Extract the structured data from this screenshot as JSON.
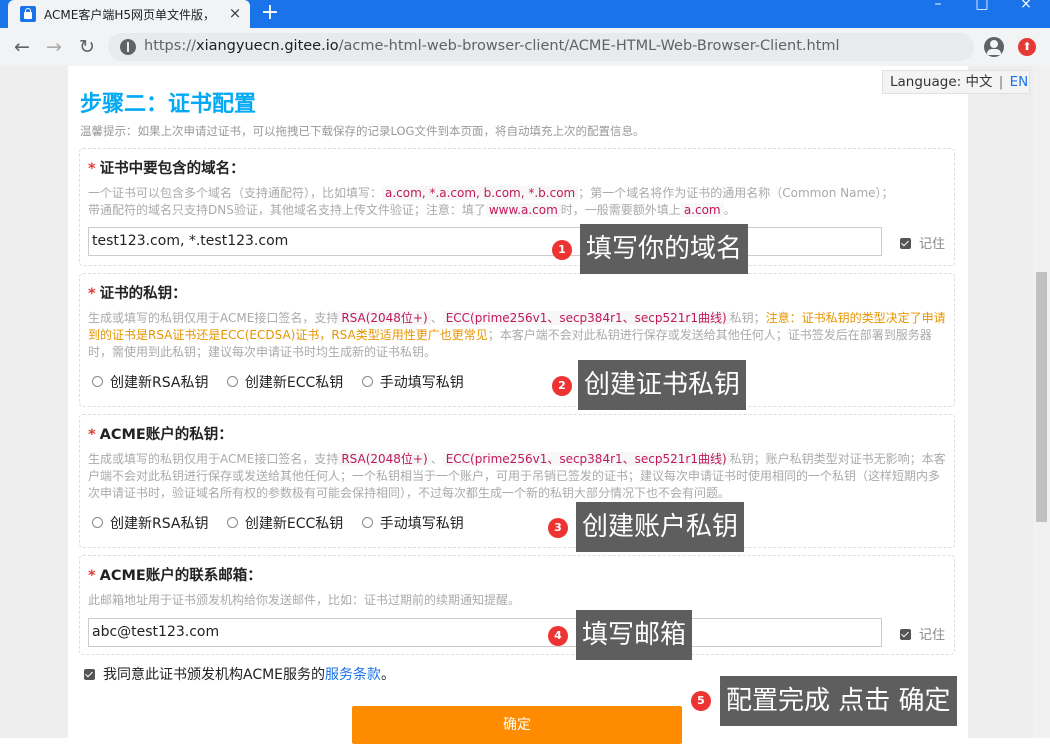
{
  "browser": {
    "tab_title": "ACME客户端H5网页单文件版，",
    "tab_close": "×",
    "new_tab": "+",
    "url_prefix": "https://",
    "url_host": "xiangyuecn.gitee.io",
    "url_path": "/acme-html-web-browser-client/ACME-HTML-Web-Browser-Client.html"
  },
  "language": {
    "label": "Language:",
    "zh": "中文",
    "sep": "|",
    "en": "EN"
  },
  "step": {
    "title": "步骤二：证书配置",
    "tip": "温馨提示：如果上次申请过证书，可以拖拽已下载保存的记录LOG文件到本页面，将自动填充上次的配置信息。"
  },
  "domains": {
    "required": "*",
    "title": "证书中要包含的域名：",
    "desc1_a": "一个证书可以包含多个域名（支持通配符），比如填写：",
    "desc1_code": "a.com, *.a.com, b.com, *.b.com",
    "desc1_b": "；第一个域名将作为证书的通用名称（Common Name）；",
    "desc2_a": "带通配符的域名只支持DNS验证，其他域名支持上传文件验证；注意：填了",
    "desc2_code1": "www.a.com",
    "desc2_b": "时，一般需要额外填上",
    "desc2_code2": "a.com",
    "desc2_c": "。",
    "value": "test123.com, *.test123.com",
    "remember": "记住"
  },
  "cert_key": {
    "required": "*",
    "title": "证书的私钥：",
    "d_a": "生成或填写的私钥仅用于ACME接口签名，支持",
    "d_rsa": "RSA(2048位+)",
    "d_sep": "、",
    "d_ecc": "ECC(prime256v1、secp384r1、secp521r1曲线)",
    "d_b": "私钥；",
    "d_warn": "注意：证书私钥的类型决定了申请到的证书是RSA证书还是ECC(ECDSA)证书，RSA类型适用性更广也更常见",
    "d_c": "；本客户端不会对此私钥进行保存或发送给其他任何人；证书签发后在部署到服务器时，需使用到此私钥；建议每次申请证书时均生成新的证书私钥。",
    "options": [
      "创建新RSA私钥",
      "创建新ECC私钥",
      "手动填写私钥"
    ]
  },
  "account_key": {
    "required": "*",
    "title": "ACME账户的私钥：",
    "d_a": "生成或填写的私钥仅用于ACME接口签名，支持",
    "d_rsa": "RSA(2048位+)",
    "d_sep": "、",
    "d_ecc": "ECC(prime256v1、secp384r1、secp521r1曲线)",
    "d_b": "私钥；账户私钥类型对证书无影响；本客户端不会对此私钥进行保存或发送给其他任何人；一个私钥相当于一个账户，可用于吊销已签发的证书；建议每次申请证书时使用相同的一个私钥（这样短期内多次申请证书时，验证域名所有权的参数极有可能会保持相同），不过每次都生成一个新的私钥大部分情况下也不会有问题。",
    "options": [
      "创建新RSA私钥",
      "创建新ECC私钥",
      "手动填写私钥"
    ]
  },
  "email": {
    "required": "*",
    "title": "ACME账户的联系邮箱：",
    "desc": "此邮箱地址用于证书颁发机构给你发送邮件，比如：证书过期前的续期通知提醒。",
    "value": "abc@test123.com",
    "remember": "记住"
  },
  "agree": {
    "text": "我同意此证书颁发机构ACME服务的",
    "link": "服务条款",
    "end": "。"
  },
  "confirm_button": "确定",
  "callouts": [
    {
      "num": "1",
      "text": "填写你的域名"
    },
    {
      "num": "2",
      "text": "创建证书私钥"
    },
    {
      "num": "3",
      "text": "创建账户私钥"
    },
    {
      "num": "4",
      "text": "填写邮箱"
    },
    {
      "num": "5",
      "text": "配置完成 点击 确定"
    }
  ],
  "colors": {
    "accent": "#03a9f4",
    "button": "#ff8c00",
    "chrome": "#1a73e8",
    "required": "#e53935",
    "warn": "#e69500"
  }
}
